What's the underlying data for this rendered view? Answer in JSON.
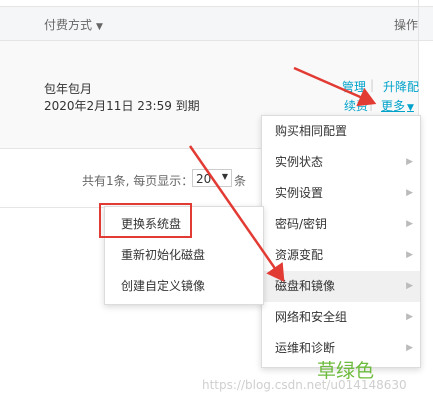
{
  "table": {
    "col_payment": "付费方式",
    "col_actions": "操作"
  },
  "row": {
    "billing": "包年包月",
    "expire": "2020年2月11日 23:59 到期",
    "actions": {
      "manage": "管理",
      "upgrade": "升降配",
      "renew": "续费",
      "more": "更多"
    }
  },
  "pagination": {
    "text": "共有1条, 每页显示：",
    "page_size": "20",
    "unit": "条"
  },
  "more_menu": {
    "items": [
      {
        "label": "购买相同配置"
      },
      {
        "label": "实例状态"
      },
      {
        "label": "实例设置"
      },
      {
        "label": "密码/密钥"
      },
      {
        "label": "资源变配"
      },
      {
        "label": "磁盘和镜像"
      },
      {
        "label": "网络和安全组"
      },
      {
        "label": "运维和诊断"
      }
    ]
  },
  "disk_submenu": {
    "items": [
      {
        "label": "更换系统盘"
      },
      {
        "label": "重新初始化磁盘"
      },
      {
        "label": "创建自定义镜像"
      }
    ]
  },
  "overlay": {
    "watermark": "https://blog.csdn.net/u014148630",
    "stamp": "草绿色",
    "annotation_color": "#e23b34"
  }
}
